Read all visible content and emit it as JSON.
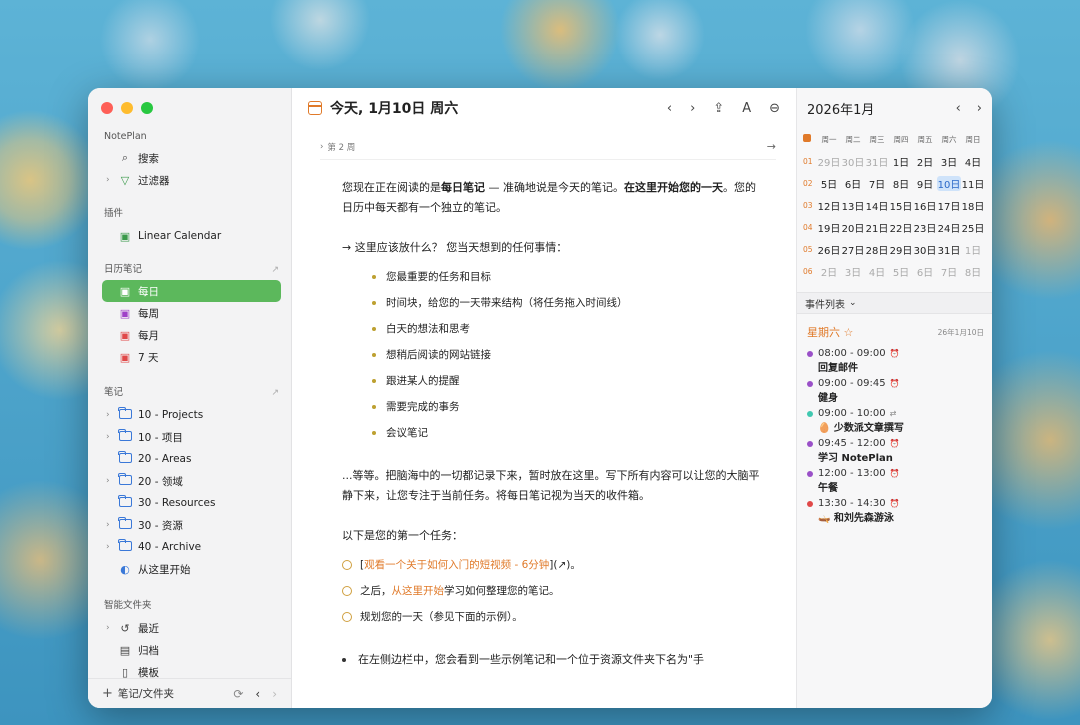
{
  "sidebar": {
    "app_name": "NotePlan",
    "top_items": [
      {
        "label": "搜索",
        "icon": "search-icon"
      },
      {
        "label": "过滤器",
        "icon": "filter-icon"
      }
    ],
    "plugins_header": "插件",
    "plugins": [
      {
        "label": "Linear Calendar",
        "icon": "calendar-icon"
      }
    ],
    "calendar_header": "日历笔记",
    "calendar_items": [
      {
        "label": "每日",
        "icon": "calendar-icon",
        "active": true
      },
      {
        "label": "每周",
        "icon": "calendar-week-icon"
      },
      {
        "label": "每月",
        "icon": "calendar-month-icon"
      },
      {
        "label": "7 天",
        "icon": "calendar-7day-icon"
      }
    ],
    "notes_header": "笔记",
    "notes_items": [
      {
        "label": "10 - Projects"
      },
      {
        "label": "10 - 项目"
      },
      {
        "label": "20 - Areas"
      },
      {
        "label": "20 - 领域"
      },
      {
        "label": "30 - Resources"
      },
      {
        "label": "30 - 资源"
      },
      {
        "label": "40 - Archive"
      },
      {
        "label": "从这里开始"
      }
    ],
    "smart_header": "智能文件夹",
    "smart_items": [
      {
        "label": "最近",
        "icon": "history-icon"
      },
      {
        "label": "归档",
        "icon": "archive-icon"
      },
      {
        "label": "模板",
        "icon": "template-icon"
      }
    ],
    "bottom_label": "笔记/文件夹"
  },
  "main": {
    "title": "今天, 1月10日 周六",
    "week_label": "第 2 周",
    "intro_1a": "您现在正在阅读的是",
    "intro_1b": "每日笔记",
    "intro_1c": " — 准确地说是今天的笔记。",
    "intro_1d": "在这里开始您的一天",
    "intro_2": "。您的日历中每天都有一个独立的笔记。",
    "question": "→ 这里应该放什么？ 您当天想到的任何事情：",
    "bullets": [
      "您最重要的任务和目标",
      "时间块，给您的一天带来结构（将任务拖入时间线）",
      "白天的想法和思考",
      "想稍后阅读的网站链接",
      "跟进某人的提醒",
      "需要完成的事务",
      "会议笔记"
    ],
    "para_2": "...等等。把脑海中的一切都记录下来，暂时放在这里。写下所有内容可以让您的大脑平静下来，让您专注于当前任务。将每日笔记视为当天的收件箱。",
    "first_task_heading": "以下是您的第一个任务：",
    "task_1_pre": "[",
    "task_1_link": "观看一个关于如何入门的短视频 - 6分钟",
    "task_1_post": "](↗)。",
    "task_2_pre": "之后，",
    "task_2_link": "从这里开始",
    "task_2_post": "学习如何整理您的笔记。",
    "task_3": "规划您的一天（参见下面的示例）。",
    "last_line": "在左侧边栏中，您会看到一些示例笔记和一个位于资源文件夹下名为\"手"
  },
  "calendar": {
    "month": "2026年1月",
    "weekdays": [
      "周一",
      "周二",
      "周三",
      "周四",
      "周五",
      "周六",
      "周日"
    ],
    "weeks": [
      {
        "wk": "01",
        "days": [
          "29日",
          "30日",
          "31日",
          "1日",
          "2日",
          "3日",
          "4日"
        ]
      },
      {
        "wk": "02",
        "days": [
          "5日",
          "6日",
          "7日",
          "8日",
          "9日",
          "10日",
          "11日"
        ]
      },
      {
        "wk": "03",
        "days": [
          "12日",
          "13日",
          "14日",
          "15日",
          "16日",
          "17日",
          "18日"
        ]
      },
      {
        "wk": "04",
        "days": [
          "19日",
          "20日",
          "21日",
          "22日",
          "23日",
          "24日",
          "25日"
        ]
      },
      {
        "wk": "05",
        "days": [
          "26日",
          "27日",
          "28日",
          "29日",
          "30日",
          "31日",
          "1日"
        ]
      },
      {
        "wk": "06",
        "days": [
          "2日",
          "3日",
          "4日",
          "5日",
          "6日",
          "7日",
          "8日"
        ]
      }
    ],
    "events_label": "事件列表",
    "day_name": "星期六 ☆",
    "day_date": "26年1月10日",
    "events": [
      {
        "time": "08:00 - 09:00",
        "title": "回复邮件",
        "color": "#9a50c8"
      },
      {
        "time": "09:00 - 09:45",
        "title": "健身",
        "color": "#9a50c8"
      },
      {
        "time": "09:00 - 10:00",
        "title": "🥚 少数派文章撰写",
        "color": "#40c8b0"
      },
      {
        "time": "09:45 - 12:00",
        "title": "学习 NotePlan",
        "color": "#9a50c8"
      },
      {
        "time": "12:00 - 13:00",
        "title": "午餐",
        "color": "#9a50c8"
      },
      {
        "time": "13:30 - 14:30",
        "title": "🛶 和刘先森游泳",
        "color": "#e04848"
      }
    ]
  }
}
